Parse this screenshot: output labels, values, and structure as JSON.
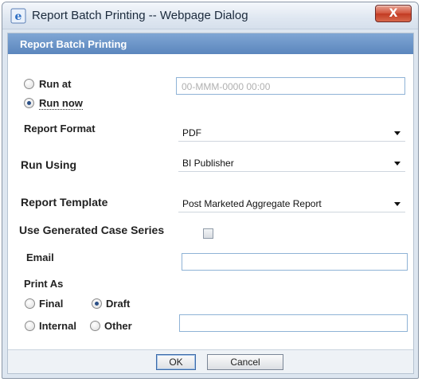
{
  "window": {
    "title": "Report Batch Printing -- Webpage Dialog",
    "close_label": "X"
  },
  "panel": {
    "header": "Report Batch Printing"
  },
  "schedule": {
    "run_at_label": "Run at",
    "run_now_label": "Run now",
    "selected": "run_now",
    "datetime_placeholder": "00-MMM-0000 00:00"
  },
  "report_format": {
    "label": "Report Format",
    "value": "PDF"
  },
  "run_using": {
    "label": "Run Using",
    "value": "BI Publisher"
  },
  "report_template": {
    "label": "Report Template",
    "value": "Post Marketed Aggregate Report"
  },
  "case_series": {
    "label": "Use Generated Case Series",
    "checked": false
  },
  "email": {
    "label": "Email",
    "value": ""
  },
  "print_as": {
    "label": "Print As",
    "final_label": "Final",
    "draft_label": "Draft",
    "internal_label": "Internal",
    "other_label": "Other",
    "selected": "draft",
    "other_value": ""
  },
  "buttons": {
    "ok_label": "OK",
    "cancel_label": "Cancel"
  },
  "colors": {
    "header_blue": "#5b86bd",
    "radio_selected": "#2a4f86"
  }
}
